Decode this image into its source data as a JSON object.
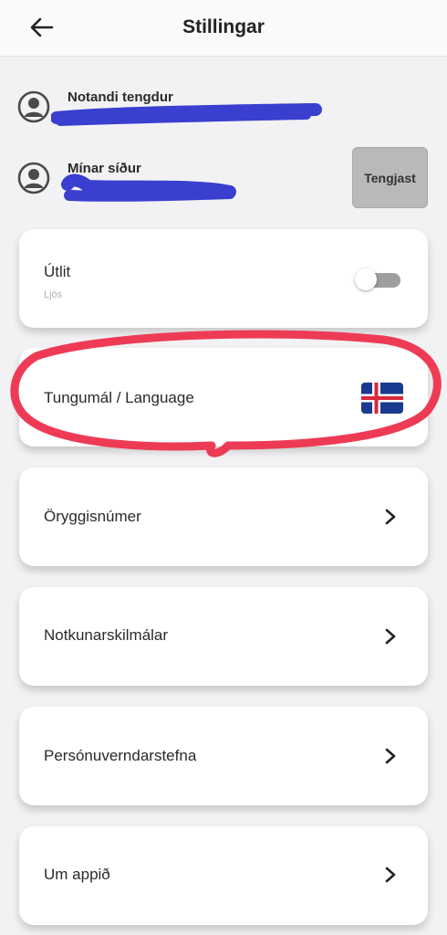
{
  "header": {
    "title": "Stillingar",
    "back_icon": "arrow-left-icon"
  },
  "account": {
    "user_label": "Notandi tengdur",
    "pages_label": "Mínar síður",
    "connect_button": "Tengjast",
    "avatar_icon": "user-circle-icon"
  },
  "settings": {
    "appearance": {
      "label": "Útlit",
      "value": "Ljós",
      "toggle_on": false
    },
    "language": {
      "label": "Tungumál / Language",
      "flag_icon": "iceland-flag-icon"
    },
    "items": [
      {
        "label": "Öryggisnúmer"
      },
      {
        "label": "Notkunarskilmálar"
      },
      {
        "label": "Persónuverndarstefna"
      },
      {
        "label": "Um appið"
      }
    ]
  },
  "colors": {
    "redaction_scribble": "#3a3fd0",
    "annotation_circle": "#ee3b55",
    "flag_blue": "#1a3a8f",
    "flag_red": "#d7283a"
  }
}
